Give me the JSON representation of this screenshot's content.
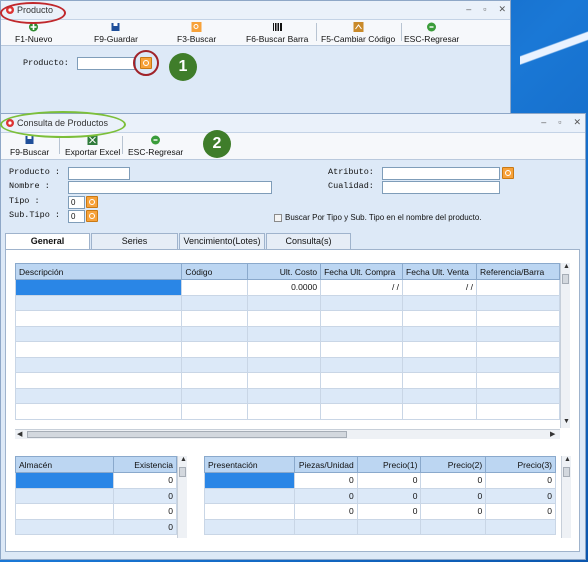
{
  "window1": {
    "title": "Producto",
    "toolbar": {
      "new": "F1-Nuevo",
      "save": "F9-Guardar",
      "search": "F3-Buscar",
      "barcode": "F6-Buscar Barra",
      "change_code": "F5-Cambiar Código",
      "back": "ESC-Regresar"
    },
    "product_label": "Producto:",
    "product_value": "",
    "badge": "1"
  },
  "window2": {
    "title": "Consulta de Productos",
    "toolbar": {
      "search": "F9-Buscar",
      "export": "Exportar Excel",
      "back": "ESC-Regresar"
    },
    "badge": "2",
    "form": {
      "producto": "Producto :",
      "nombre": "Nombre :",
      "tipo": "Tipo :",
      "subtipo": "Sub.Tipo :",
      "atributo": "Atributo:",
      "cualidad": "Cualidad:",
      "tipo_value": "0",
      "subtipo_value": "0",
      "checkbox_label": "Buscar Por Tipo y Sub. Tipo en el nombre del producto."
    },
    "tabs": [
      "General",
      "Series",
      "Vencimiento(Lotes)",
      "Consulta(s)"
    ],
    "main_grid": {
      "headers": [
        "Descripción",
        "Código",
        "Ult. Costo",
        "Fecha Ult. Compra",
        "Fecha Ult. Venta",
        "Referencia/Barra"
      ],
      "row1": [
        "",
        "",
        "0.0000",
        "/ /",
        "/ /",
        ""
      ]
    },
    "stock_grid": {
      "headers": [
        "Almacén",
        "Existencia"
      ],
      "values": [
        "0",
        "0",
        "0",
        "0"
      ]
    },
    "price_grid": {
      "headers": [
        "Presentación",
        "Piezas/Unidad",
        "Precio(1)",
        "Precio(2)",
        "Precio(3)"
      ],
      "rows": [
        [
          "",
          "0",
          "0",
          "0",
          "0"
        ],
        [
          "",
          "0",
          "0",
          "0",
          "0"
        ],
        [
          "",
          "0",
          "0",
          "0",
          "0"
        ]
      ]
    }
  },
  "colors": {
    "annotation_red": "#c0282c",
    "annotation_green": "#7cbf3a",
    "badge_green": "#3f7d2a",
    "selection": "#2a86e6"
  }
}
